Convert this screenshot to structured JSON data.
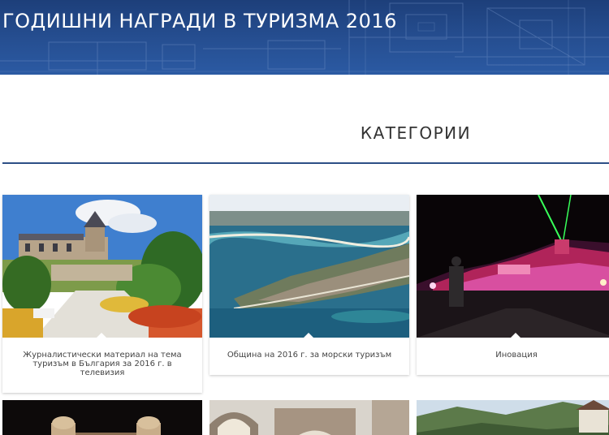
{
  "header": {
    "title": "ГОДИШНИ НАГРАДИ В ТУРИЗМА 2016"
  },
  "section": {
    "title": "КАТЕГОРИИ"
  },
  "categories": [
    {
      "label": "Журналистически материал на тема туризъм в България за 2016 г. в телевизия"
    },
    {
      "label": "Община на 2016 г. за морски туризъм"
    },
    {
      "label": "Иновация"
    }
  ],
  "colors": {
    "banner": "#264f92",
    "divider": "#2d4f86"
  }
}
